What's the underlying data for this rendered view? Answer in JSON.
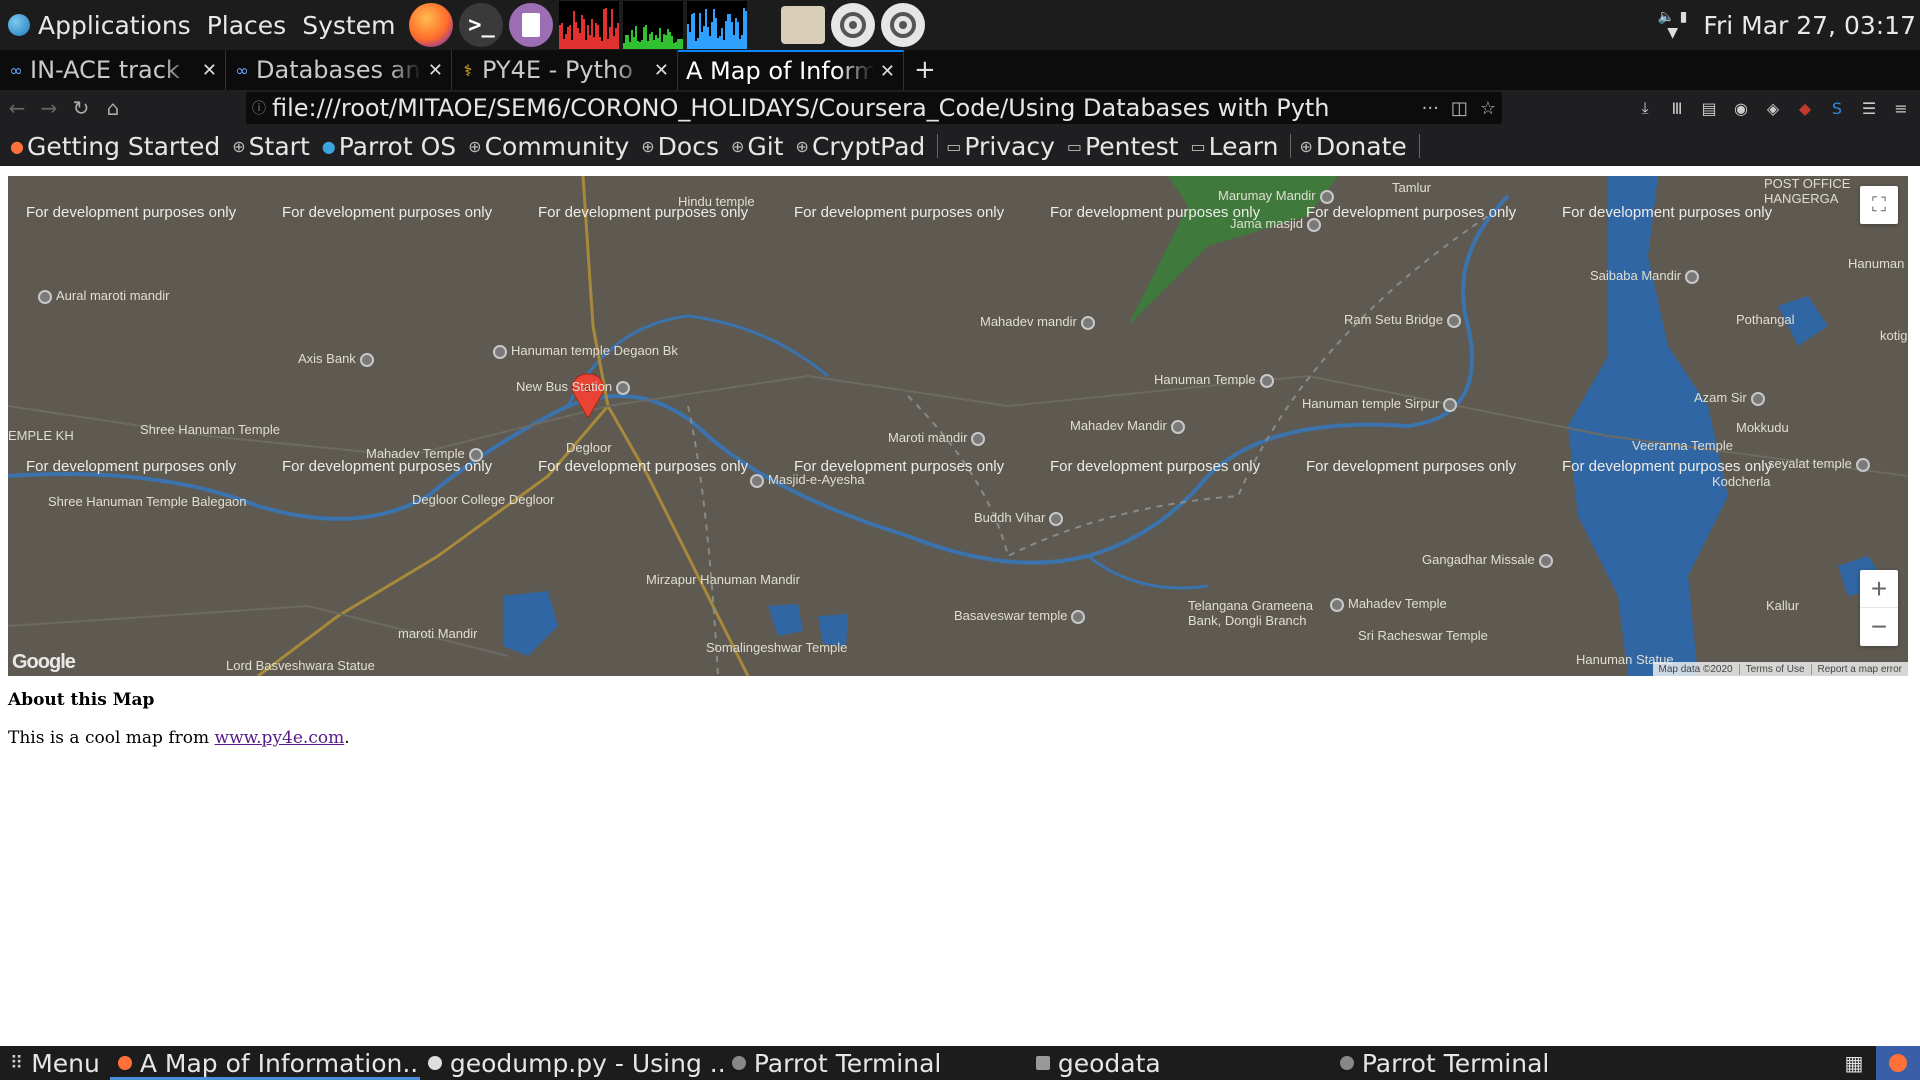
{
  "system_panel": {
    "menus": [
      "Applications",
      "Places",
      "System"
    ],
    "clock": "Fri Mar 27, 03:17"
  },
  "tabs": [
    {
      "title": "IN-ACE track",
      "icon": "infinity-icon"
    },
    {
      "title": "Databases an",
      "icon": "infinity-icon"
    },
    {
      "title": "PY4E - Pytho",
      "icon": "python-icon"
    },
    {
      "title": "A Map of Inform",
      "icon": "none",
      "active": true
    }
  ],
  "navbar": {
    "url": "file:///root/MITAOE/SEM6/CORONO_HOLIDAYS/Coursera_Code/Using Databases with Pyth"
  },
  "bookmarks": [
    {
      "label": "Getting Started",
      "icon": "firefox-icon"
    },
    {
      "label": "Start",
      "icon": "globe-icon"
    },
    {
      "label": "Parrot OS",
      "icon": "parrot-icon"
    },
    {
      "label": "Community",
      "icon": "globe-icon"
    },
    {
      "label": "Docs",
      "icon": "globe-icon"
    },
    {
      "label": "Git",
      "icon": "globe-icon"
    },
    {
      "label": "CryptPad",
      "icon": "globe-icon"
    },
    {
      "label": "Privacy",
      "icon": "folder-icon"
    },
    {
      "label": "Pentest",
      "icon": "folder-icon"
    },
    {
      "label": "Learn",
      "icon": "folder-icon"
    },
    {
      "label": "Donate",
      "icon": "globe-icon"
    }
  ],
  "map": {
    "watermark": "For development purposes only",
    "attribution": [
      "Map data ©2020",
      "Terms of Use",
      "Report a map error"
    ],
    "logo": "Google",
    "zoom_in": "+",
    "zoom_out": "−",
    "places": [
      "Aural maroti mandir",
      "Axis Bank",
      "Hanuman temple Degaon Bk",
      "New Bus Station",
      "Shree Hanuman Temple",
      "Mahadev Temple",
      "Degloor",
      "Degloor College Degloor",
      "Shree Hanuman Temple Balegaon",
      "maroti Mandir",
      "Lord Basveshwara Statue",
      "Hindu temple",
      "Mirzapur Hanuman Mandir",
      "Somalingeshwar Temple",
      "Masjid-e-Ayesha",
      "Maroti mandir",
      "Mahadev mandir",
      "Hanuman Temple",
      "Mahadev Mandir",
      "Buddh Vihar",
      "Basaveswar temple",
      "Marumay Mandir",
      "Tamlur",
      "Jama masjid",
      "Ram Setu Bridge",
      "Hanuman temple Sirpur",
      "Gangadhar Missale",
      "Telangana Grameena Bank, Dongli Branch",
      "Mahadev Temple",
      "Sri Racheswar Temple",
      "Hanuman Statue",
      "Saibaba Mandir",
      "Pothangal",
      "Azam Sir",
      "Mokkudu",
      "Veeranna Temple",
      "seyalat temple",
      "Kodcherla",
      "Kallur",
      "POST OFFICE HANGERGA",
      "Hanuman",
      "kotig",
      "EMPLE KH"
    ]
  },
  "content": {
    "heading": "About this Map",
    "text_before": "This is a cool map from ",
    "link_text": "www.py4e.com",
    "text_after": "."
  },
  "taskbar": {
    "menu": "Menu",
    "items": [
      {
        "label": "A Map of Information...",
        "active": true
      },
      {
        "label": "geodump.py - Using ...",
        "active": false
      },
      {
        "label": "Parrot Terminal",
        "active": false
      },
      {
        "label": "geodata",
        "active": false
      },
      {
        "label": "Parrot Terminal",
        "active": false
      }
    ]
  }
}
